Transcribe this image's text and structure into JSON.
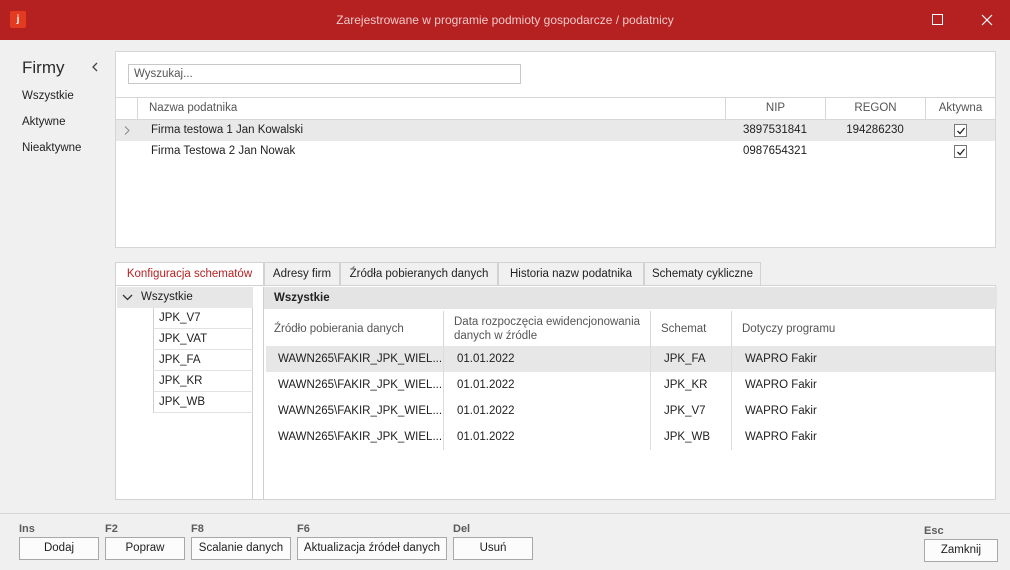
{
  "window": {
    "title": "Zarejestrowane w programie podmioty gospodarcze / podatnicy",
    "logo_letter": "j"
  },
  "sidebar": {
    "title": "Firmy",
    "items": [
      {
        "label": "Wszystkie"
      },
      {
        "label": "Aktywne"
      },
      {
        "label": "Nieaktywne"
      }
    ]
  },
  "search": {
    "placeholder": "Wyszukaj...",
    "value": ""
  },
  "companies": {
    "columns": [
      "Nazwa podatnika",
      "NIP",
      "REGON",
      "Aktywna"
    ],
    "rows": [
      {
        "name": "Firma testowa 1 Jan Kowalski",
        "nip": "3897531841",
        "regon": "194286230",
        "active": true
      },
      {
        "name": "Firma Testowa 2 Jan Nowak",
        "nip": "0987654321",
        "regon": "",
        "active": true
      }
    ]
  },
  "tabs": [
    {
      "label": "Konfiguracja schematów",
      "active": true
    },
    {
      "label": "Adresy firm"
    },
    {
      "label": "Źródła pobieranych danych"
    },
    {
      "label": "Historia nazw podatnika"
    },
    {
      "label": "Schematy cykliczne"
    }
  ],
  "tree": {
    "root": "Wszystkie",
    "items": [
      "JPK_V7",
      "JPK_VAT",
      "JPK_FA",
      "JPK_KR",
      "JPK_WB"
    ]
  },
  "detail": {
    "header": "Wszystkie",
    "columns": [
      "Źródło pobierania danych",
      "Data rozpoczęcia ewidencjonowania danych w źródle",
      "Schemat",
      "Dotyczy programu"
    ],
    "rows": [
      {
        "source": "WAWN265\\FAKIR_JPK_WIEL...",
        "date": "01.01.2022",
        "schema": "JPK_FA",
        "program": "WAPRO Fakir"
      },
      {
        "source": "WAWN265\\FAKIR_JPK_WIEL...",
        "date": "01.01.2022",
        "schema": "JPK_KR",
        "program": "WAPRO Fakir"
      },
      {
        "source": "WAWN265\\FAKIR_JPK_WIEL...",
        "date": "01.01.2022",
        "schema": "JPK_V7",
        "program": "WAPRO Fakir"
      },
      {
        "source": "WAWN265\\FAKIR_JPK_WIEL...",
        "date": "01.01.2022",
        "schema": "JPK_WB",
        "program": "WAPRO Fakir"
      }
    ]
  },
  "footer": {
    "buttons": [
      {
        "key": "Ins",
        "label": "Dodaj"
      },
      {
        "key": "F2",
        "label": "Popraw"
      },
      {
        "key": "F8",
        "label": "Scalanie danych"
      },
      {
        "key": "F6",
        "label": "Aktualizacja źródeł danych"
      },
      {
        "key": "Del",
        "label": "Usuń"
      }
    ],
    "close": {
      "key": "Esc",
      "label": "Zamknij"
    }
  },
  "colors": {
    "titlebar": "#b52021",
    "active_tab_text": "#b52021",
    "selected_row": "#e9e9e9"
  }
}
